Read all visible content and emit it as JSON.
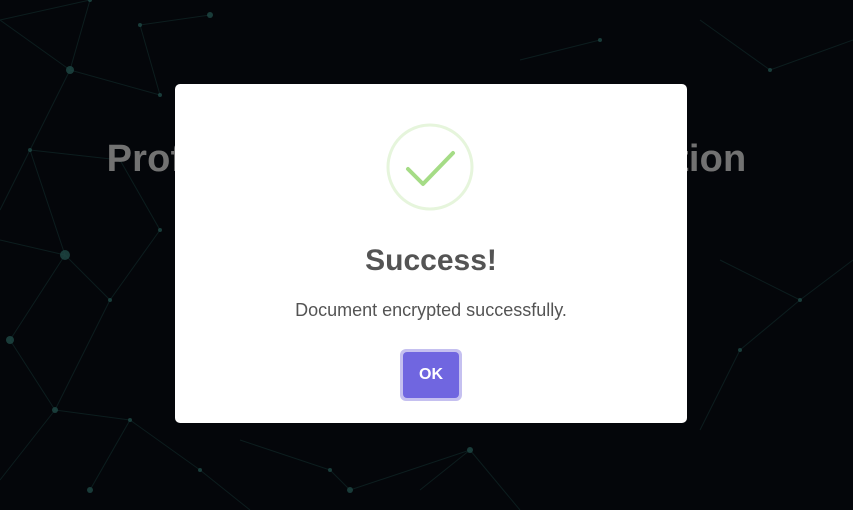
{
  "page": {
    "heading": "Professional Document Encryption"
  },
  "dialog": {
    "icon": "success-check-icon",
    "title": "Success!",
    "message": "Document encrypted successfully.",
    "confirm_label": "OK"
  },
  "colors": {
    "background": "#06090f",
    "network_lines": "#1f4a4a",
    "success_icon": "#a5dc86",
    "confirm_button": "#7066e0",
    "text": "#545454"
  }
}
